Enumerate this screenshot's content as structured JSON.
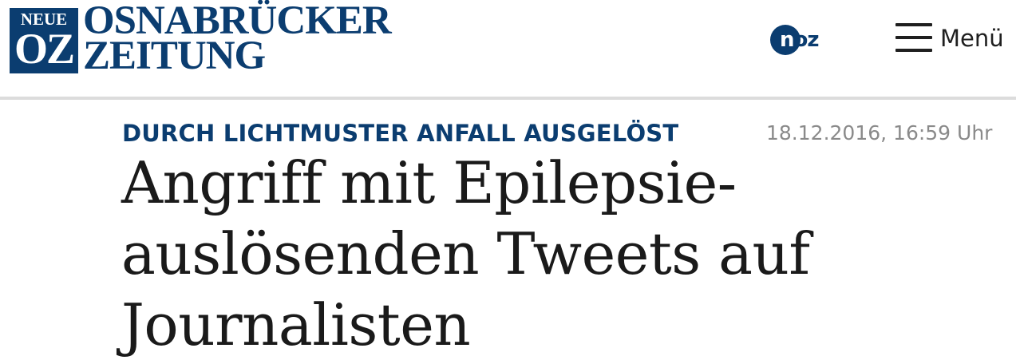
{
  "header": {
    "logo": {
      "box_top": "NEUE",
      "box_bottom": "OZ",
      "title_line1": "OSNABRÜCKER",
      "title_line2": "ZEITUNG"
    },
    "noz_badge": {
      "first_letter": "n",
      "rest": "oz"
    },
    "menu": {
      "icon": "hamburger-menu-icon",
      "label": "Menü"
    }
  },
  "article": {
    "kicker": "DURCH LICHTMUSTER ANFALL AUSGELÖST",
    "timestamp": "18.12.2016, 16:59 Uhr",
    "headline_lines": [
      "Angriff mit Epilepsie-",
      "auslösenden Tweets auf",
      "Journalisten"
    ]
  },
  "colors": {
    "brand_blue": "#0b3d70",
    "text_dark": "#1a1a1a",
    "timestamp_gray": "#8a8a8a",
    "divider_gray": "#dcdcdc"
  }
}
